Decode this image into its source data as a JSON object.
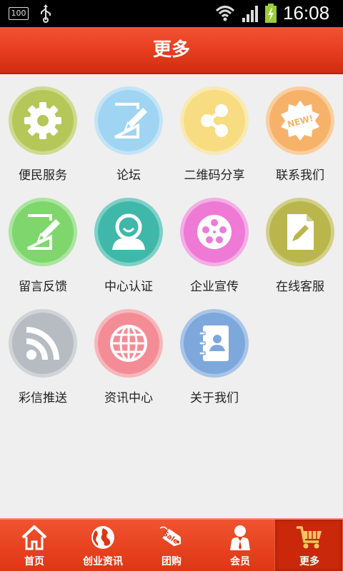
{
  "status_bar": {
    "battery_left_text": "100",
    "time": "16:08"
  },
  "header": {
    "title": "更多"
  },
  "grid": {
    "items": [
      {
        "label": "便民服务",
        "icon": "gear-icon",
        "color": "#b6c75a"
      },
      {
        "label": "论坛",
        "icon": "edit-icon",
        "color": "#9fd5f2"
      },
      {
        "label": "二维码分享",
        "icon": "share-icon",
        "color": "#f7dc82"
      },
      {
        "label": "联系我们",
        "icon": "new-badge-icon",
        "color": "#f7b26a"
      },
      {
        "label": "留言反馈",
        "icon": "message-edit-icon",
        "color": "#7fd66d"
      },
      {
        "label": "中心认证",
        "icon": "user-icon",
        "color": "#3fb8aa"
      },
      {
        "label": "企业宣传",
        "icon": "film-reel-icon",
        "color": "#ee7ad6"
      },
      {
        "label": "在线客服",
        "icon": "document-pen-icon",
        "color": "#b9b64b"
      },
      {
        "label": "彩信推送",
        "icon": "rss-icon",
        "color": "#b7bcc2"
      },
      {
        "label": "资讯中心",
        "icon": "globe-icon",
        "color": "#f48c96"
      },
      {
        "label": "关于我们",
        "icon": "contacts-book-icon",
        "color": "#7ea8dc"
      }
    ]
  },
  "tabbar": {
    "tabs": [
      {
        "label": "首页",
        "icon": "home-icon"
      },
      {
        "label": "创业资讯",
        "icon": "globe-icon"
      },
      {
        "label": "团购",
        "icon": "sale-tag-icon",
        "tag_text": "Sale"
      },
      {
        "label": "会员",
        "icon": "member-icon"
      },
      {
        "label": "更多",
        "icon": "cart-icon",
        "active": true
      }
    ]
  }
}
